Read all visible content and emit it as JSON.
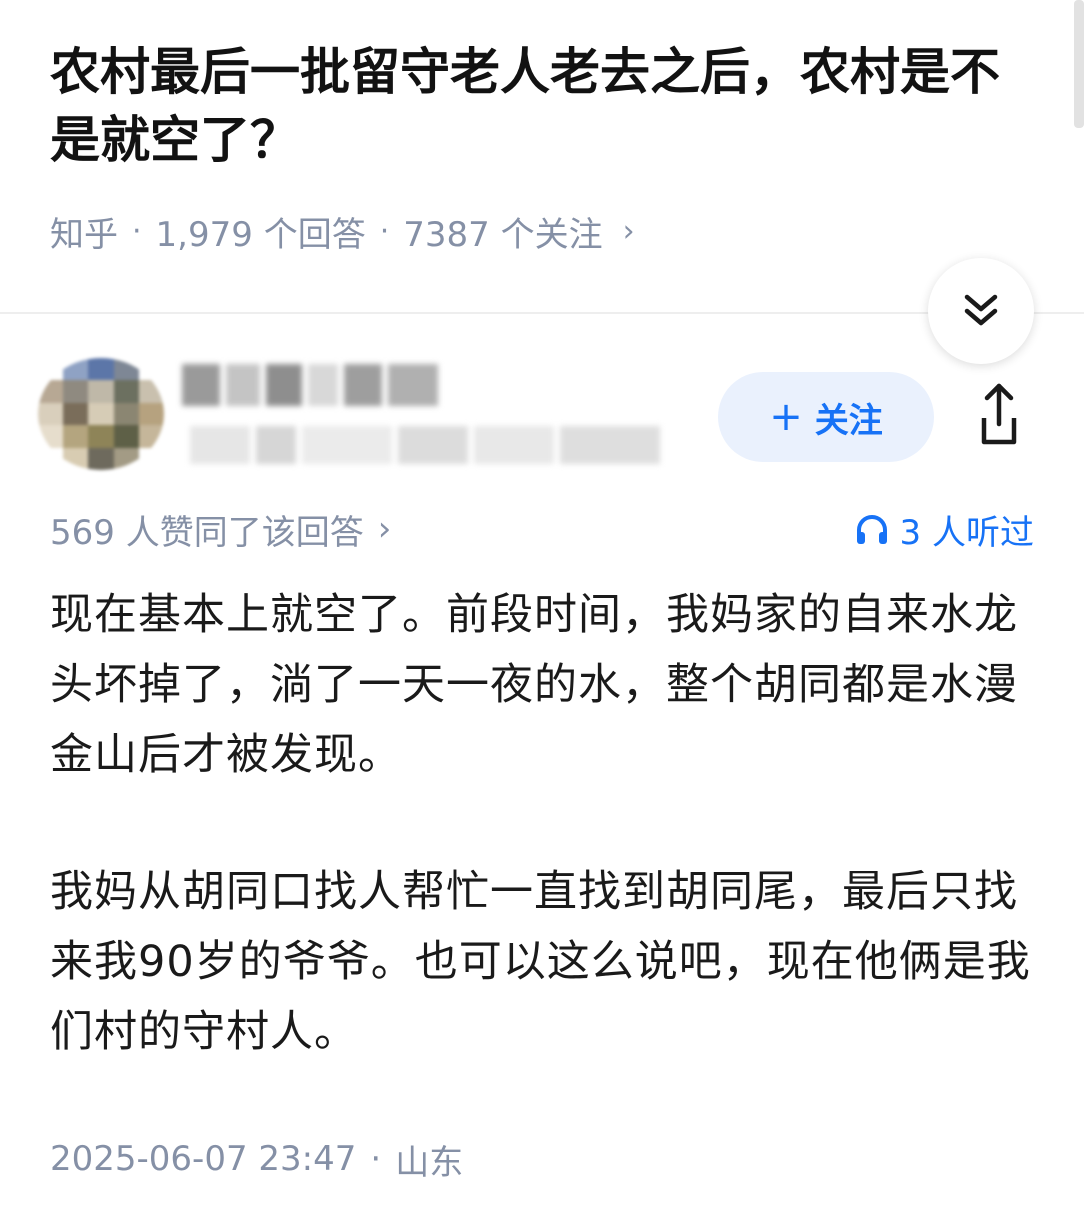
{
  "question": {
    "title": "农村最后一批留守老人老去之后，农村是不是就空了？",
    "source": "知乎",
    "answers_count": "1,979 个回答",
    "followers_count": "7387 个关注"
  },
  "author": {
    "follow_label": "关注"
  },
  "answer": {
    "votes_text": "569 人赞同了该回答",
    "listen_text": "3 人听过",
    "paragraphs": [
      "现在基本上就空了。前段时间，我妈家的自来水龙头坏掉了，淌了一天一夜的水，整个胡同都是水漫金山后才被发现。",
      "我妈从胡同口找人帮忙一直找到胡同尾，最后只找来我90岁的爷爷。也可以这么说吧，现在他俩是我们村的守村人。"
    ],
    "time": "2025-06-07 23:47",
    "location": "山东"
  },
  "icons": {
    "collapse": "chevron-double-down-icon",
    "share": "share-icon",
    "listen": "headphones-icon"
  },
  "colors": {
    "accent": "#1772f6",
    "meta_text": "#8590a6",
    "follow_bg": "#eaf1fd"
  }
}
